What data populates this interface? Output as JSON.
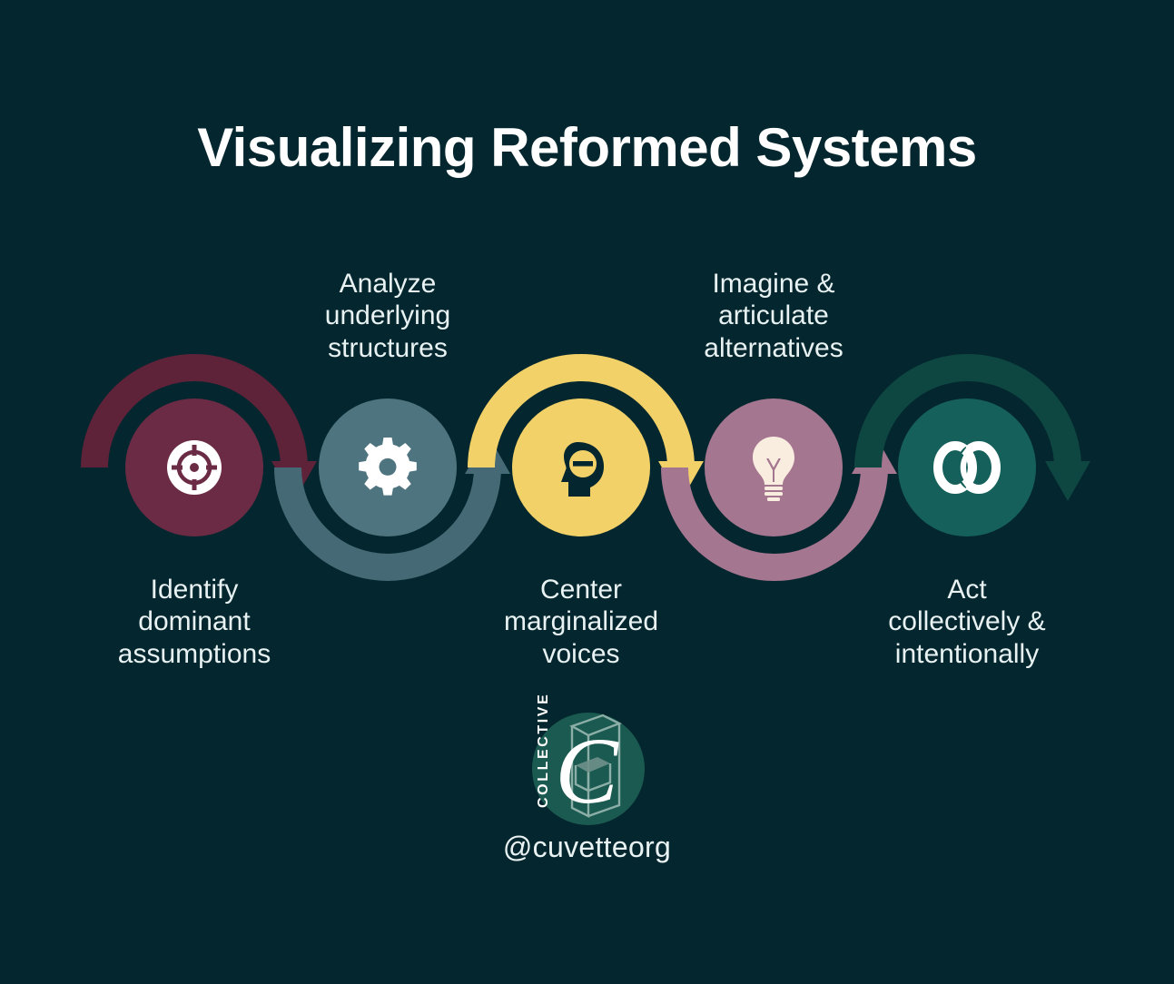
{
  "page": {
    "title": "Visualizing Reformed Systems",
    "background_color": "#04262E",
    "text_color": "#E8F2F2"
  },
  "diagram": {
    "type": "process-cycle",
    "step_count": 5,
    "steps": [
      {
        "index": 1,
        "label": "Identify\ndominant\nassumptions",
        "label_position": "bottom",
        "icon": "crosshair-target-icon",
        "circle_color": "#6B2B44",
        "arc_color": "#5E2239",
        "arc_direction": "over",
        "icon_color": "#FFFFFF"
      },
      {
        "index": 2,
        "label": "Analyze\nunderlying\nstructures",
        "label_position": "top",
        "icon": "gear-icon",
        "circle_color": "#4E7480",
        "arc_color": "#456975",
        "arc_direction": "under",
        "icon_color": "#FFFFFF"
      },
      {
        "index": 3,
        "label": "Center\nmarginalized\nvoices",
        "label_position": "bottom",
        "icon": "head-minus-icon",
        "circle_color": "#F2D268",
        "arc_color": "#F2D268",
        "arc_direction": "over",
        "icon_color": "#04262E"
      },
      {
        "index": 4,
        "label": "Imagine &\narticulate\nalternatives",
        "label_position": "top",
        "icon": "lightbulb-icon",
        "circle_color": "#A5768F",
        "arc_color": "#A5768F",
        "arc_direction": "under",
        "icon_color": "#F9EDDF"
      },
      {
        "index": 5,
        "label": "Act\ncollectively &\nintentionally",
        "label_position": "bottom",
        "icon": "linked-rings-icon",
        "circle_color": "#15605A",
        "arc_color": "#0E4741",
        "arc_direction": "over",
        "icon_color": "#FFFFFF"
      }
    ]
  },
  "footer": {
    "logo": {
      "name": "cuvette-collective-logo",
      "wordmark": "COLLECTIVE",
      "monogram": "C",
      "circle_color": "#1B5A51"
    },
    "handle": "@cuvetteorg"
  }
}
